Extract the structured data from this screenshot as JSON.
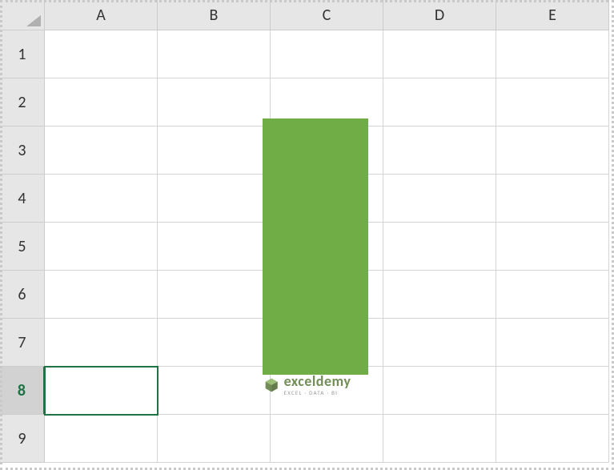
{
  "columns": [
    "A",
    "B",
    "C",
    "D",
    "E"
  ],
  "rows": [
    "1",
    "2",
    "3",
    "4",
    "5",
    "6",
    "7",
    "8",
    "9"
  ],
  "activeRow": "8",
  "activeCell": "A8",
  "shape": {
    "fill": "#70AD47",
    "type": "rectangle"
  },
  "watermark": {
    "brand": "exceldemy",
    "tagline": "EXCEL · DATA · BI"
  }
}
